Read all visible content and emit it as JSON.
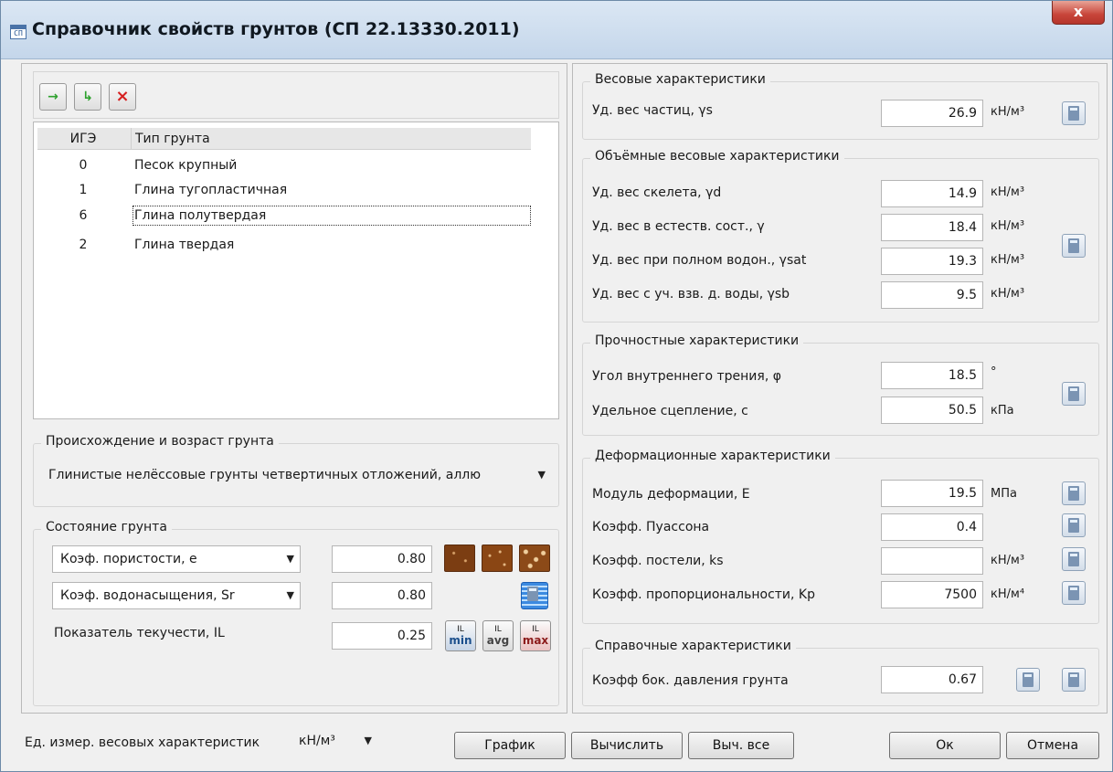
{
  "window": {
    "title": "Справочник свойств грунтов (СП 22.13330.2011)",
    "close": "x",
    "app_icon": "СП"
  },
  "toolbar": {
    "add": "→",
    "insert": "↳",
    "delete": "×"
  },
  "table": {
    "headers": [
      "ИГЭ",
      "Тип грунта"
    ],
    "rows": [
      {
        "id": "0",
        "name": "Песок крупный"
      },
      {
        "id": "1",
        "name": "Глина тугопластичная"
      },
      {
        "id": "6",
        "name": "Глина полутвердая"
      },
      {
        "id": "2",
        "name": "Глина твердая"
      }
    ]
  },
  "origin": {
    "title": "Происхождение и возраст грунта",
    "value": "Глинистые нелёссовые грунты четвертичных отложений, аллю"
  },
  "state": {
    "title": "Состояние грунта",
    "porosity_label": "Коэф. пористости, e",
    "porosity_value": "0.80",
    "saturation_label": "Коэф. водонасыщения, Sr",
    "saturation_value": "0.80",
    "fluidity_label": "Показатель текучести, IL",
    "fluidity_value": "0.25",
    "il_min": "min",
    "il_avg": "avg",
    "il_max": "max",
    "il_sym": "IL"
  },
  "weight": {
    "title": "Весовые характеристики",
    "particles_label": "Уд. вес частиц, γs",
    "particles_value": "26.9",
    "unit": "кН/м³"
  },
  "volume": {
    "title": "Объёмные весовые характеристики",
    "items": [
      {
        "label": "Уд. вес скелета, γd",
        "value": "14.9",
        "unit": "кН/м³"
      },
      {
        "label": "Уд. вес в естеств. сост., γ",
        "value": "18.4",
        "unit": "кН/м³"
      },
      {
        "label": "Уд. вес при полном водон., γsat",
        "value": "19.3",
        "unit": "кН/м³"
      },
      {
        "label": "Уд. вес с уч. взв. д. воды, γsb",
        "value": "9.5",
        "unit": "кН/м³"
      }
    ]
  },
  "strength": {
    "title": "Прочностные характеристики",
    "items": [
      {
        "label": "Угол внутреннего трения, φ",
        "value": "18.5",
        "unit": "°"
      },
      {
        "label": "Удельное сцепление, c",
        "value": "50.5",
        "unit": "кПа"
      }
    ]
  },
  "deform": {
    "title": "Деформационные характеристики",
    "items": [
      {
        "label": "Модуль деформации, E",
        "value": "19.5",
        "unit": "МПа"
      },
      {
        "label": "Коэфф. Пуассона",
        "value": "0.4",
        "unit": ""
      },
      {
        "label": "Коэфф. постели, ks",
        "value": "",
        "unit": "кН/м³"
      },
      {
        "label": "Коэфф. пропорциональности, Kp",
        "value": "7500",
        "unit": "кН/м⁴"
      }
    ]
  },
  "reference": {
    "title": "Справочные характеристики",
    "label": "Коэфф бок. давления грунта",
    "value": "0.67"
  },
  "footer": {
    "units_label": "Ед. измер. весовых характеристик",
    "units_value": "кН/м³",
    "chart": "График",
    "calc": "Вычислить",
    "calc_all": "Выч. все",
    "ok": "Ок",
    "cancel": "Отмена"
  }
}
